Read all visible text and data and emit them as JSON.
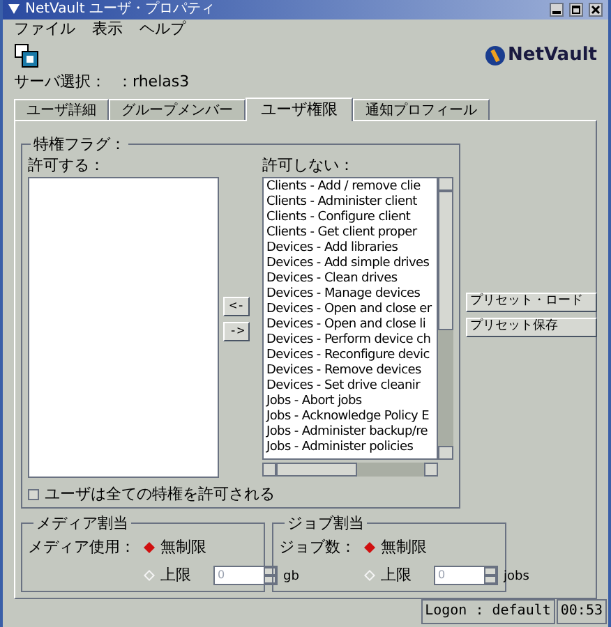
{
  "window": {
    "title": "NetVault ユーザ・プロパティ"
  },
  "menu": [
    "ファイル",
    "表示",
    "ヘルプ"
  ],
  "logo": {
    "text": "NetVault"
  },
  "server_select": {
    "label": "サーバ選択：",
    "value": "：rhelas3"
  },
  "tabs": [
    {
      "label": "ユーザ詳細",
      "selected": false
    },
    {
      "label": "グループメンバー",
      "selected": false
    },
    {
      "label": "ユーザ権限",
      "selected": true
    },
    {
      "label": "通知プロフィール",
      "selected": false
    }
  ],
  "privileges": {
    "title": "特権フラグ：",
    "allowed_label": "許可する：",
    "denied_label": "許可しない：",
    "denied_items": [
      "Clients - Add / remove clie",
      "Clients - Administer client",
      "Clients - Configure client",
      "Clients - Get client proper",
      "Devices - Add libraries",
      "Devices - Add simple drives",
      "Devices - Clean drives",
      "Devices - Manage devices",
      "Devices - Open and close er",
      "Devices - Open and close li",
      "Devices - Perform device ch",
      "Devices - Reconfigure devic",
      "Devices - Remove devices",
      "Devices - Set drive cleanir",
      "Jobs - Abort jobs",
      "Jobs - Acknowledge Policy E",
      "Jobs - Administer backup/re",
      "Jobs - Administer policies"
    ],
    "move_buttons": [
      "<-",
      "->"
    ],
    "all_privileges": {
      "label": "ユーザは全ての特権を許可される",
      "checked": false
    }
  },
  "preset_buttons": [
    "プリセット・ロード",
    "プリセット保存"
  ],
  "media_quota": {
    "title": "メディア割当",
    "label": "メディア使用：",
    "options": [
      {
        "label": "無制限",
        "selected": true
      },
      {
        "label": "上限",
        "selected": false
      }
    ],
    "limit_value": "0",
    "unit": "gb"
  },
  "job_quota": {
    "title": "ジョブ割当",
    "label": "ジョブ数：",
    "options": [
      {
        "label": "無制限",
        "selected": true
      },
      {
        "label": "上限",
        "selected": false
      }
    ],
    "limit_value": "0",
    "unit": "jobs"
  },
  "status_bar": {
    "logon": "Logon : default",
    "time": "00:53"
  }
}
